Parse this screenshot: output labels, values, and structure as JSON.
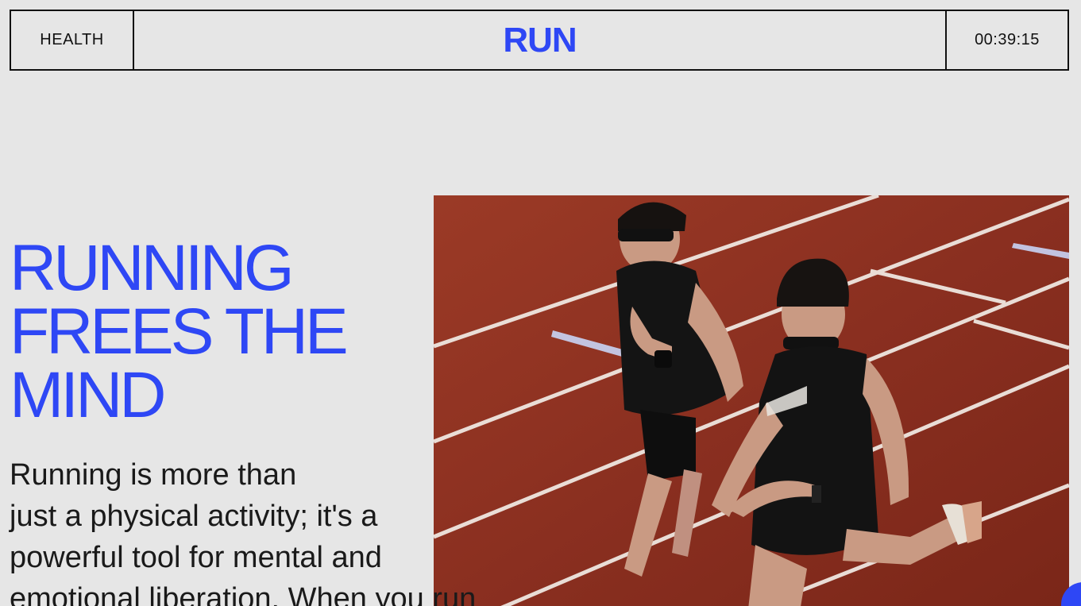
{
  "header": {
    "left_label": "HEALTH",
    "brand": "RUN",
    "timer": "00:39:15"
  },
  "hero": {
    "headline_lines": [
      "RUNNING",
      "FREES THE",
      "MIND"
    ],
    "body_lines": [
      "Running is more than",
      "just a physical activity; it's a",
      "powerful tool for mental and",
      "emotional liberation. When you run"
    ]
  },
  "colors": {
    "accent": "#2e47f5",
    "background": "#e6e6e6",
    "text": "#1a1a1a",
    "track": "#8a2f20"
  },
  "icons": {
    "chat_button": "chat-bubble-icon"
  }
}
